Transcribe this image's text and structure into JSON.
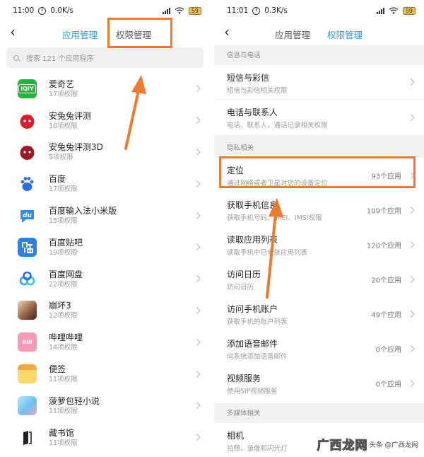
{
  "left": {
    "status": {
      "time": "11:00",
      "speed": "0.0K/s",
      "battery": "59"
    },
    "nav": {
      "tab_app": "应用管理",
      "tab_perm": "权限管理"
    },
    "search": {
      "placeholder": "搜索 121 个应用程序"
    },
    "apps": [
      {
        "name": "爱奇艺",
        "sub": "17项权限",
        "icon": "iqiyi-icon",
        "color": "#1fb63b"
      },
      {
        "name": "安兔兔评测",
        "sub": "10项权限",
        "icon": "antutu-icon",
        "color": "#d71f2c"
      },
      {
        "name": "安兔兔评测3D",
        "sub": "5项权限",
        "icon": "antutu-3d-icon",
        "color": "#b81c2a"
      },
      {
        "name": "百度",
        "sub": "17项权限",
        "icon": "baidu-icon",
        "color": "#ffffff"
      },
      {
        "name": "百度输入法小米版",
        "sub": "15项权限",
        "icon": "baidu-input-icon",
        "color": "#2f8fea"
      },
      {
        "name": "百度贴吧",
        "sub": "19项权限",
        "icon": "tieba-icon",
        "color": "#2f7fea"
      },
      {
        "name": "百度网盘",
        "sub": "22项权限",
        "icon": "netdisk-icon",
        "color": "#ffffff"
      },
      {
        "name": "崩坏3",
        "sub": "12项权限",
        "icon": "honkai-icon",
        "color": "#c98a5c"
      },
      {
        "name": "哔哩哔哩",
        "sub": "14项权限",
        "icon": "bilibili-icon",
        "color": "#f59ab6"
      },
      {
        "name": "便签",
        "sub": "11项权限",
        "icon": "notes-icon",
        "color": "#f7c542"
      },
      {
        "name": "菠萝包轻小说",
        "sub": "11项权限",
        "icon": "boluobao-icon",
        "color": "#6cc1ef"
      },
      {
        "name": "藏书馆",
        "sub": "11项权限",
        "icon": "book-icon",
        "color": "#ffffff"
      }
    ]
  },
  "right": {
    "status": {
      "time": "11:01",
      "speed": "0.3K/s",
      "battery": "59"
    },
    "nav": {
      "tab_app": "应用管理",
      "tab_perm": "权限管理"
    },
    "sections": {
      "info": "信息与电话",
      "privacy": "隐私相关",
      "media": "多媒体相关"
    },
    "perms": [
      {
        "name": "短信与彩信",
        "sub": "短信与彩信相关权限",
        "count": ""
      },
      {
        "name": "电话与联系人",
        "sub": "电话、联系人，通话记录相关权限",
        "count": ""
      },
      {
        "name": "定位",
        "sub": "通过网络或者卫星对您的设备定位",
        "count": "93个应用"
      },
      {
        "name": "获取手机信息",
        "sub": "获取手机号码、IMEI、IMSI权限",
        "count": "109个应用"
      },
      {
        "name": "读取应用列表",
        "sub": "读取手机中已安装应用列表",
        "count": "120个应用"
      },
      {
        "name": "访问日历",
        "sub": "访问日历",
        "count": "20个应用"
      },
      {
        "name": "访问手机账户",
        "sub": "获取手机的账户列表",
        "count": "49个应用"
      },
      {
        "name": "添加语音邮件",
        "sub": "向系统添加语音邮件",
        "count": "0个应用"
      },
      {
        "name": "视频服务",
        "sub": "使用SIP视频服务",
        "count": "0个应用"
      },
      {
        "name": "相机",
        "sub": "拍照、录像和闪光灯",
        "count": ""
      }
    ]
  },
  "watermark": {
    "logo": "广西龙网",
    "author": "头条 @广西龙网"
  },
  "colors": {
    "accent": "#2b9ce8",
    "highlight": "#ee7a30"
  }
}
